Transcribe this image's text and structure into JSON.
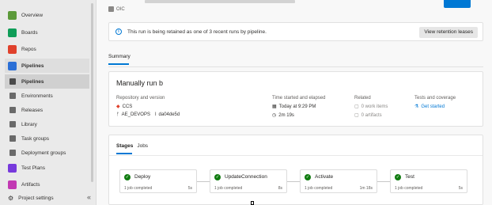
{
  "sidebar": {
    "items": [
      {
        "label": "Overview",
        "color": "#5c9a3a"
      },
      {
        "label": "Boards",
        "color": "#0f9d58"
      },
      {
        "label": "Repos",
        "color": "#e0412c"
      },
      {
        "label": "Pipelines",
        "color": "#2b6fd6"
      },
      {
        "label": "Pipelines",
        "color": "#4a4a4a"
      },
      {
        "label": "Environments",
        "color": "#6a6a6a"
      },
      {
        "label": "Releases",
        "color": "#6a6a6a"
      },
      {
        "label": "Library",
        "color": "#6a6a6a"
      },
      {
        "label": "Task groups",
        "color": "#6a6a6a"
      },
      {
        "label": "Deployment groups",
        "color": "#6a6a6a"
      },
      {
        "label": "Test Plans",
        "color": "#773adc"
      },
      {
        "label": "Artifacts",
        "color": "#c239b3"
      }
    ],
    "settings_label": "Project settings",
    "collapse_icon": "«"
  },
  "header": {
    "project": "OIC"
  },
  "banner": {
    "message": "This run is being retained as one of 3 recent runs by pipeline.",
    "button": "View retention leases"
  },
  "summary_tab": "Summary",
  "run": {
    "title": "Manually run b",
    "repo_header": "Repository and version",
    "repo_name": "CCS",
    "branch": "AE_DEVOPS",
    "commit": "da04de5d",
    "time_header": "Time started and elapsed",
    "started": "Today at 9:29 PM",
    "elapsed": "2m 19s",
    "related_header": "Related",
    "work_items": "0 work items",
    "artifacts": "0 artifacts",
    "tests_header": "Tests and coverage",
    "tests_link": "Get started"
  },
  "stages": {
    "tabs": [
      "Stages",
      "Jobs"
    ],
    "items": [
      {
        "name": "Deploy",
        "jobs": "1 job completed",
        "duration": "5s"
      },
      {
        "name": "UpdateConnection",
        "jobs": "1 job completed",
        "duration": "8s"
      },
      {
        "name": "Activate",
        "jobs": "1 job completed",
        "duration": "1m 18s"
      },
      {
        "name": "Test",
        "jobs": "1 job completed",
        "duration": "5s"
      }
    ]
  }
}
